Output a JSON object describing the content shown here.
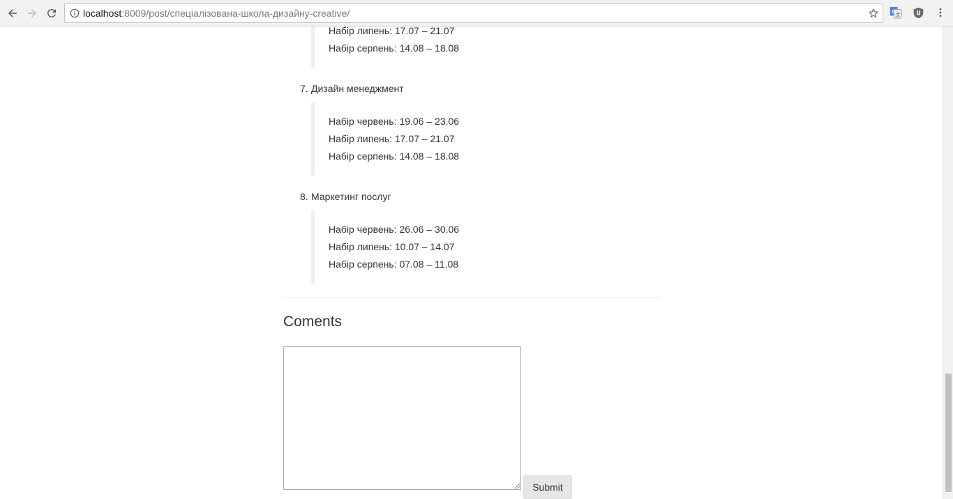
{
  "browser": {
    "url_host": "localhost",
    "url_rest": ":8009/post/спеціалізована-школа-дизайну-creative/"
  },
  "sections": [
    {
      "number": "",
      "title": "",
      "entries": [
        "Набір липень: 17.07 – 21.07",
        "Набір серпень: 14.08 – 18.08"
      ]
    },
    {
      "number": "7.",
      "title": "Дизайн менеджмент",
      "entries": [
        "Набір червень: 19.06 – 23.06",
        "Набір липень: 17.07 – 21.07",
        "Набір серпень: 14.08 – 18.08"
      ]
    },
    {
      "number": "8.",
      "title": "Маркетинг послуг",
      "entries": [
        "Набір червень: 26.06 – 30.06",
        "Набір липень: 10.07 – 14.07",
        "Набір серпень: 07.08 – 11.08"
      ]
    }
  ],
  "comments": {
    "heading": "Coments",
    "textarea_value": "",
    "submit_label": "Submit"
  },
  "icons": {
    "back": "back-arrow-icon",
    "forward": "forward-arrow-icon",
    "reload": "reload-icon",
    "info": "info-icon",
    "bookmark": "star-icon",
    "translate": "google-translate-icon",
    "ublock": "ublock-shield-icon",
    "menu": "kebab-menu-icon"
  }
}
